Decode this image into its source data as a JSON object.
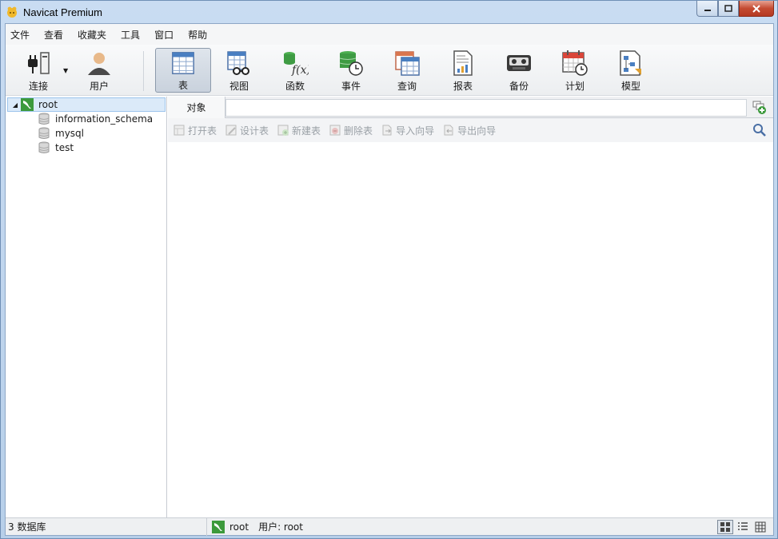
{
  "window": {
    "title": "Navicat Premium"
  },
  "menu": {
    "items": [
      "文件",
      "查看",
      "收藏夹",
      "工具",
      "窗口",
      "帮助"
    ]
  },
  "toolbar": {
    "connect": "连接",
    "user": "用户",
    "table": "表",
    "view": "视图",
    "function": "函数",
    "event": "事件",
    "query": "查询",
    "report": "报表",
    "backup": "备份",
    "schedule": "计划",
    "model": "模型"
  },
  "tree": {
    "connection": "root",
    "databases": [
      "information_schema",
      "mysql",
      "test"
    ]
  },
  "tabs": {
    "objects": "对象"
  },
  "object_toolbar": {
    "open_table": "打开表",
    "design_table": "设计表",
    "new_table": "新建表",
    "delete_table": "删除表",
    "import_wizard": "导入向导",
    "export_wizard": "导出向导"
  },
  "status": {
    "db_count": "3 数据库",
    "connection": "root",
    "user": "用户: root"
  },
  "colors": {
    "accent": "#3c9a3c",
    "selection": "#dbeaf9"
  }
}
